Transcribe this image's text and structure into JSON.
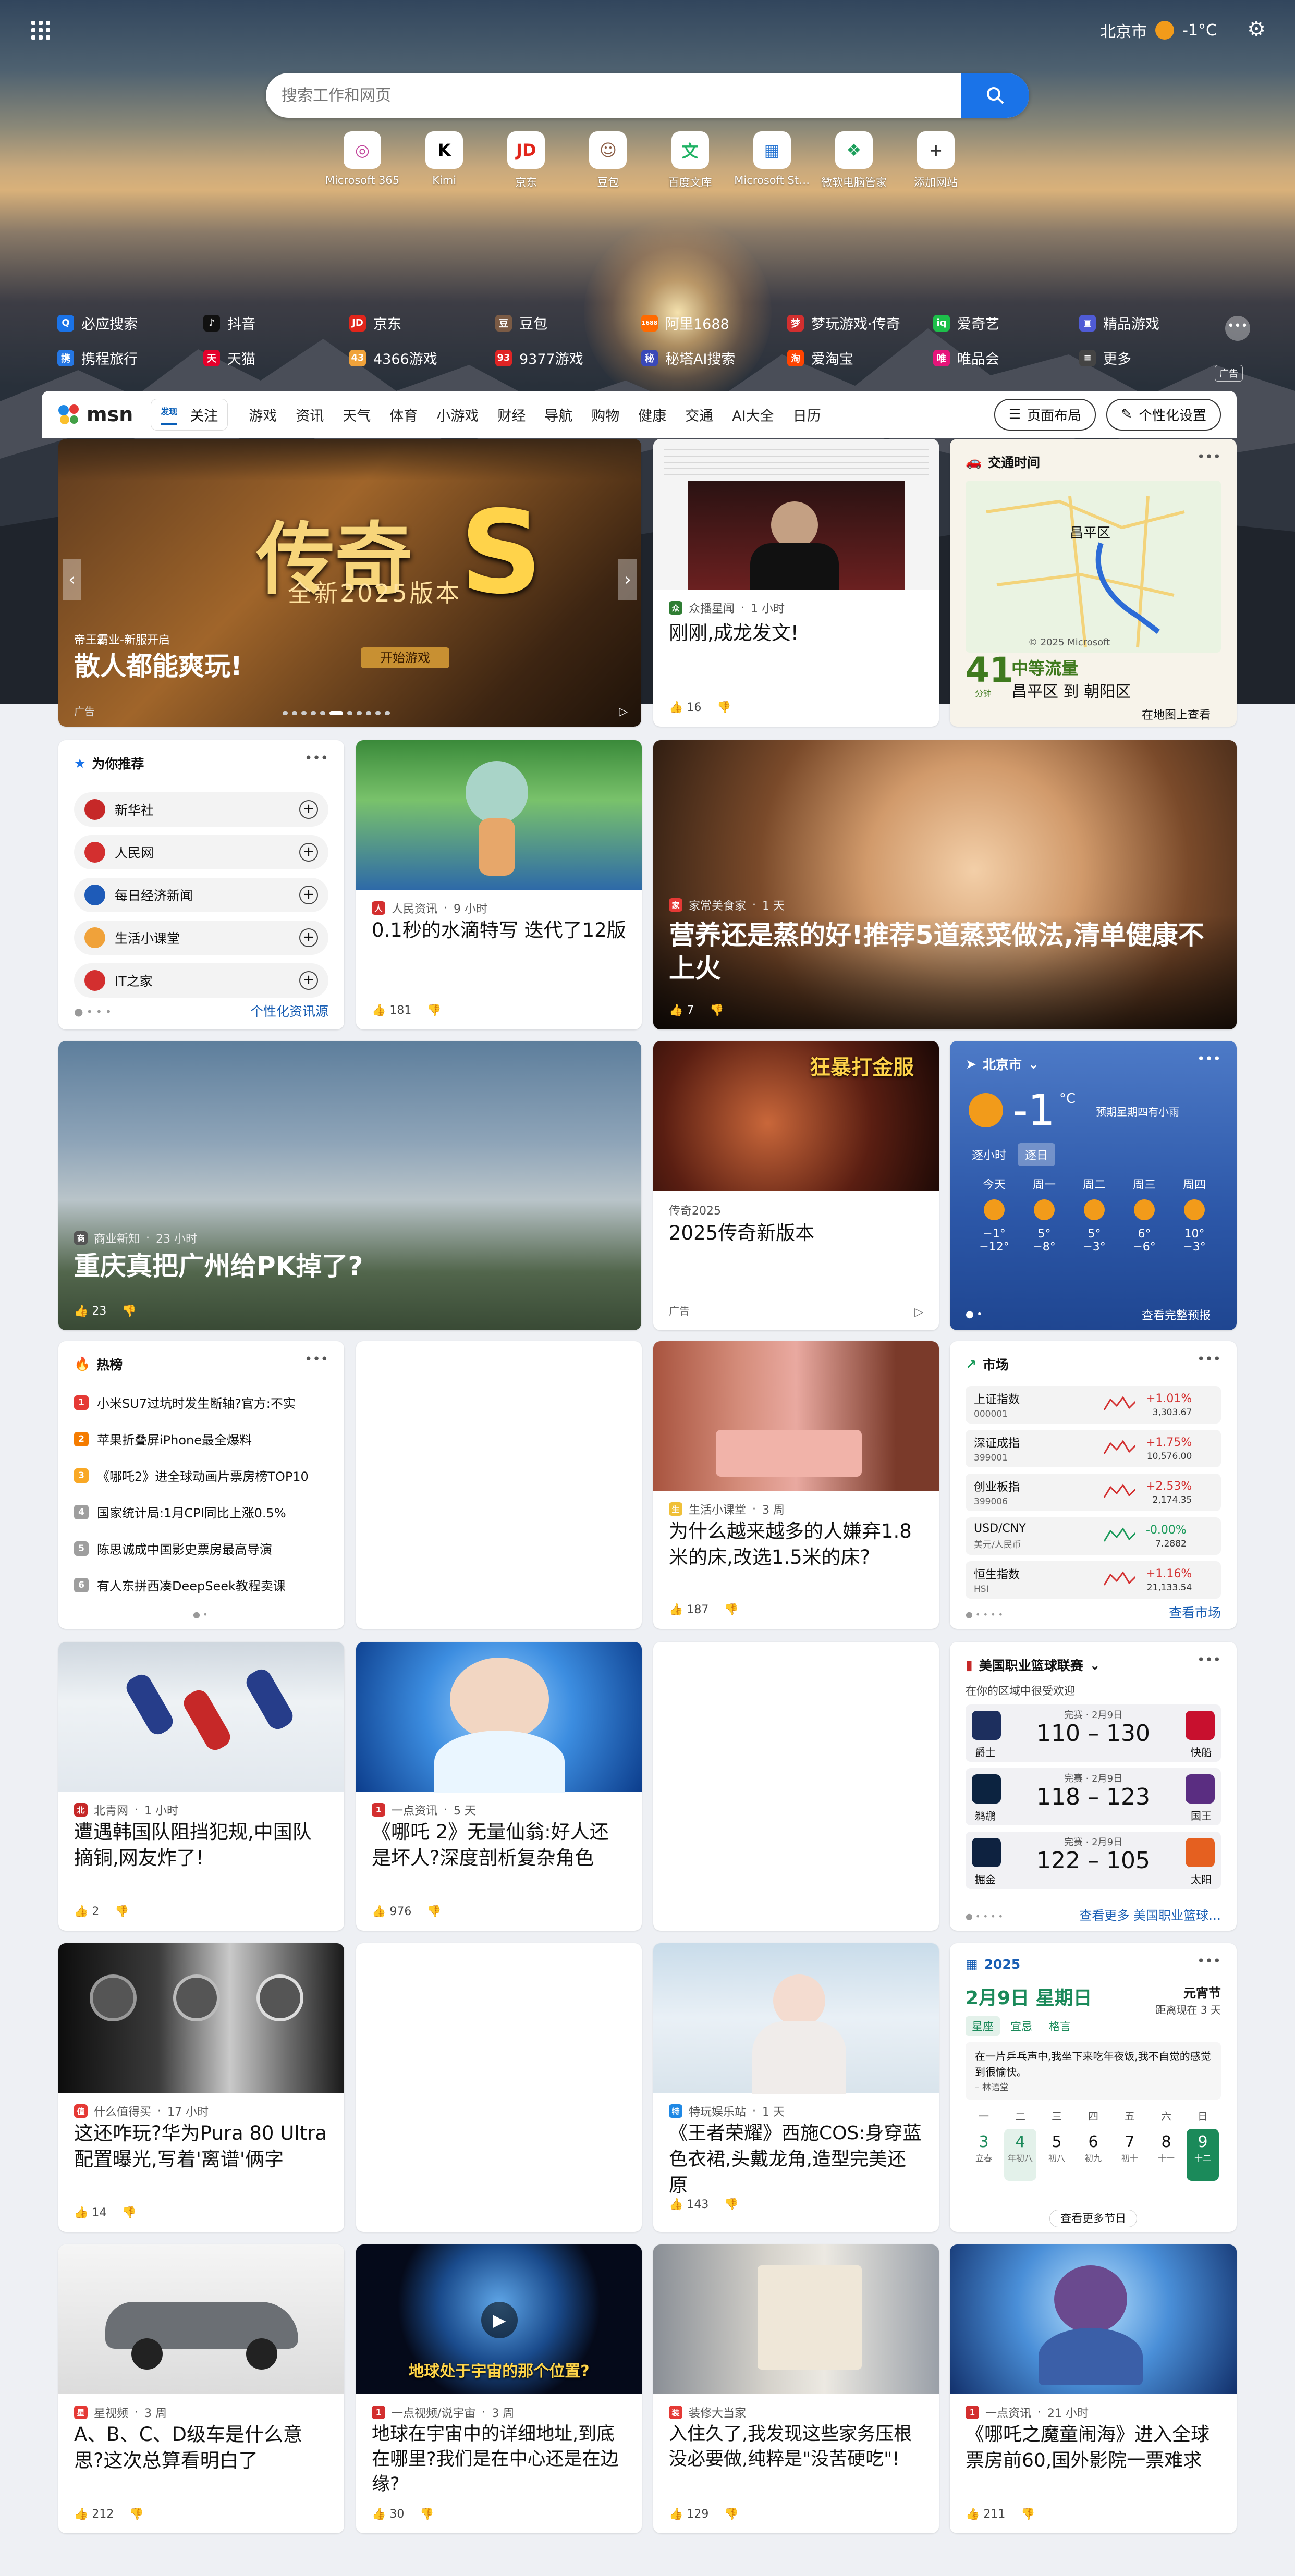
{
  "topbar": {
    "city": "北京市",
    "temp": "-1°C"
  },
  "search": {
    "placeholder": "搜索工作和网页"
  },
  "sites": [
    {
      "label": "Microsoft 365",
      "glyph": "◎",
      "color": "#c2449b"
    },
    {
      "label": "Kimi",
      "glyph": "K",
      "color": "#000000"
    },
    {
      "label": "京东",
      "glyph": "JD",
      "color": "#e1251b"
    },
    {
      "label": "豆包",
      "glyph": "☺",
      "color": "#8a5c44"
    },
    {
      "label": "百度文库",
      "glyph": "文",
      "color": "#1fb264"
    },
    {
      "label": "Microsoft St…",
      "glyph": "▦",
      "color": "#2b78d4"
    },
    {
      "label": "微软电脑管家",
      "glyph": "❖",
      "color": "#1a9e5a"
    },
    {
      "label": "添加网站",
      "glyph": "+",
      "color": "#333333"
    }
  ],
  "quick_links": [
    {
      "label": "必应搜索",
      "icon": "Q",
      "color": "#1a73e8"
    },
    {
      "label": "抖音",
      "icon": "♪",
      "color": "#111111"
    },
    {
      "label": "京东",
      "icon": "JD",
      "color": "#e1251b"
    },
    {
      "label": "豆包",
      "icon": "豆",
      "color": "#7b5b45"
    },
    {
      "label": "阿里1688",
      "icon": "1688",
      "color": "#ff6a00"
    },
    {
      "label": "梦玩游戏·传奇",
      "icon": "梦",
      "color": "#d22f2f"
    },
    {
      "label": "爱奇艺",
      "icon": "iq",
      "color": "#1dbf4a"
    },
    {
      "label": "精品游戏",
      "icon": "▣",
      "color": "#4f5bd5"
    },
    {
      "label": "携程旅行",
      "icon": "携",
      "color": "#2577e3"
    },
    {
      "label": "天猫",
      "icon": "天",
      "color": "#e4002b"
    },
    {
      "label": "4366游戏",
      "icon": "43",
      "color": "#f0a23a"
    },
    {
      "label": "9377游戏",
      "icon": "93",
      "color": "#e02424"
    },
    {
      "label": "秘塔AI搜索",
      "icon": "秘",
      "color": "#3a49b8"
    },
    {
      "label": "爱淘宝",
      "icon": "淘",
      "color": "#ff4400"
    },
    {
      "label": "唯品会",
      "icon": "唯",
      "color": "#e6157a"
    },
    {
      "label": "更多",
      "icon": "≡",
      "color": "#444444"
    }
  ],
  "ad_tag": "广告",
  "nav": {
    "logo": "msn",
    "tabs_seg": [
      "发现",
      "关注"
    ],
    "tabs": [
      "游戏",
      "资讯",
      "天气",
      "体育",
      "小游戏",
      "财经",
      "导航",
      "购物",
      "健康",
      "交通",
      "AI大全",
      "日历"
    ],
    "layout_btn": "页面布局",
    "personalize_btn": "个性化设置"
  },
  "cards": {
    "hero_ad": {
      "source": "帝王霸业-新服开启",
      "title": "散人都能爽玩!",
      "ad": "广告",
      "art_text": "传奇",
      "art_sub": "全新2025版本",
      "art_btn": "开始游戏"
    },
    "chenglong": {
      "source": "众播星闻",
      "time": "1 小时",
      "title": "刚刚,成龙发文!",
      "likes": "16"
    },
    "traffic": {
      "header": "交通时间",
      "minutes": "41",
      "unit": "分钟",
      "level": "中等流量",
      "route": "昌平区 到 朝阳区",
      "map_link": "在地图上查看",
      "map_label": "昌平区",
      "map_copy": "© 2025 Microsoft"
    },
    "recommend": {
      "header": "为你推荐",
      "sources": [
        "新华社",
        "人民网",
        "每日经济新闻",
        "生活小课堂",
        "IT之家"
      ],
      "link": "个性化资讯源"
    },
    "water": {
      "source": "人民资讯",
      "time": "9 小时",
      "title": "0.1秒的水滴特写 迭代了12版",
      "likes": "181"
    },
    "meatball": {
      "source": "家常美食家",
      "time": "1 天",
      "title": "营养还是蒸的好!推荐5道蒸菜做法,清单健康不上火",
      "likes": "7"
    },
    "chongqing": {
      "source": "商业新知",
      "time": "23 小时",
      "title": "重庆真把广州给PK掉了?",
      "likes": "23"
    },
    "game_ad": {
      "source": "传奇2025",
      "title": "2025传奇新版本",
      "ad": "广告",
      "art_text": "狂暴打金服"
    },
    "weather": {
      "city": "北京市",
      "temp": "-1",
      "unit": "°C",
      "note": "预期星期四有小雨",
      "tab_hourly": "逐小时",
      "tab_daily": "逐日",
      "link": "查看完整预报",
      "days": [
        {
          "d": "今天",
          "hi": "−1°",
          "lo": "−12°"
        },
        {
          "d": "周一",
          "hi": "5°",
          "lo": "−8°"
        },
        {
          "d": "周二",
          "hi": "5°",
          "lo": "−3°"
        },
        {
          "d": "周三",
          "hi": "6°",
          "lo": "−6°"
        },
        {
          "d": "周四",
          "hi": "10°",
          "lo": "−3°"
        }
      ]
    },
    "hot": {
      "header": "热榜",
      "items": [
        "小米SU7过坑时发生断轴?官方:不实",
        "苹果折叠屏iPhone最全爆料",
        "《哪吒2》进全球动画片票房榜TOP10",
        "国家统计局:1月CPI同比上涨0.5%",
        "陈思诚成中国影史票房最高导演",
        "有人东拼西凑DeepSeek教程卖课"
      ]
    },
    "bed": {
      "source": "生活小课堂",
      "time": "3 周",
      "title": "为什么越来越多的人嫌弃1.8米的床,改选1.5米的床?",
      "likes": "187"
    },
    "market": {
      "header": "市场",
      "link": "查看市场",
      "rows": [
        {
          "name": "上证指数",
          "code": "000001",
          "pct": "+1.01%",
          "val": "3,303.67",
          "up": true
        },
        {
          "name": "深证成指",
          "code": "399001",
          "pct": "+1.75%",
          "val": "10,576.00",
          "up": true
        },
        {
          "name": "创业板指",
          "code": "399006",
          "pct": "+2.53%",
          "val": "2,174.35",
          "up": true
        },
        {
          "name": "USD/CNY",
          "code": "美元/人民币",
          "pct": "-0.00%",
          "val": "7.2882",
          "up": false
        },
        {
          "name": "恒生指数",
          "code": "HSI",
          "pct": "+1.16%",
          "val": "21,133.54",
          "up": true
        }
      ]
    },
    "skating": {
      "source": "北青网",
      "time": "1 小时",
      "title": "遭遇韩国队阻挡犯规,中国队摘铜,网友炸了!",
      "likes": "2"
    },
    "nezha": {
      "source": "一点资讯",
      "time": "5 天",
      "title": "《哪吒 2》无量仙翁:好人还是坏人?深度剖析复杂角色",
      "likes": "976"
    },
    "nba": {
      "header": "美国职业篮球联赛",
      "sub": "在你的区域中很受欢迎",
      "link": "查看更多 美国职业篮球…",
      "games": [
        {
          "status": "完赛 · 2月9日",
          "score": "110 – 130",
          "home": "爵士",
          "away": "快船",
          "c1": "#1d2f5e",
          "c2": "#c8102e"
        },
        {
          "status": "完赛 · 2月9日",
          "score": "118 – 123",
          "home": "鹈鹕",
          "away": "国王",
          "c1": "#0c2340",
          "c2": "#5a2d81"
        },
        {
          "status": "完赛 · 2月9日",
          "score": "122 – 105",
          "home": "掘金",
          "away": "太阳",
          "c1": "#0e2240",
          "c2": "#e56020"
        }
      ]
    },
    "huawei": {
      "source": "什么值得买",
      "time": "17 小时",
      "title": "这还咋玩?华为Pura 80 Ultra配置曝光,写着'离谱'俩字",
      "likes": "14"
    },
    "cosplay": {
      "source": "特玩娱乐站",
      "time": "1 天",
      "title": "《王者荣耀》西施COS:身穿蓝色衣裙,头戴龙角,造型完美还原",
      "likes": "143"
    },
    "calendar": {
      "year": "2025",
      "date": "2月9日 星期日",
      "festival": "元宵节",
      "countdown": "距离现在 3 天",
      "tabs": [
        "星座",
        "宜忌",
        "格言"
      ],
      "quote": "在一片乒乓声中,我坐下来吃年夜饭,我不自觉的感觉到很愉快。",
      "quote_by": "– 林语堂",
      "week": [
        "一",
        "二",
        "三",
        "四",
        "五",
        "六",
        "日"
      ],
      "days": [
        {
          "n": "3",
          "s": "立春"
        },
        {
          "n": "4",
          "s": "年初八"
        },
        {
          "n": "5",
          "s": "初八"
        },
        {
          "n": "6",
          "s": "初九"
        },
        {
          "n": "7",
          "s": "初十"
        },
        {
          "n": "8",
          "s": "十一"
        },
        {
          "n": "9",
          "s": "十二"
        }
      ],
      "link": "查看更多节日"
    },
    "car": {
      "source": "星视频",
      "time": "3 周",
      "title": "A、B、C、D级车是什么意思?这次总算看明白了",
      "likes": "212"
    },
    "earth": {
      "source": "一点视频/说宇宙",
      "time": "3 周",
      "title": "地球在宇宙中的详细地址,到底在哪里?我们是在中心还是在边缘?",
      "likes": "30",
      "overlay": "地球处于宇宙的那个位置?"
    },
    "house": {
      "source": "装修大当家",
      "time": "",
      "title": "入住久了,我发现这些家务压根没必要做,纯粹是\"没苦硬吃\"!",
      "likes": "129"
    },
    "nezha2": {
      "source": "一点资讯",
      "time": "21 小时",
      "title": "《哪吒之魔童闹海》进入全球票房前60,国外影院一票难求",
      "likes": "211"
    }
  }
}
